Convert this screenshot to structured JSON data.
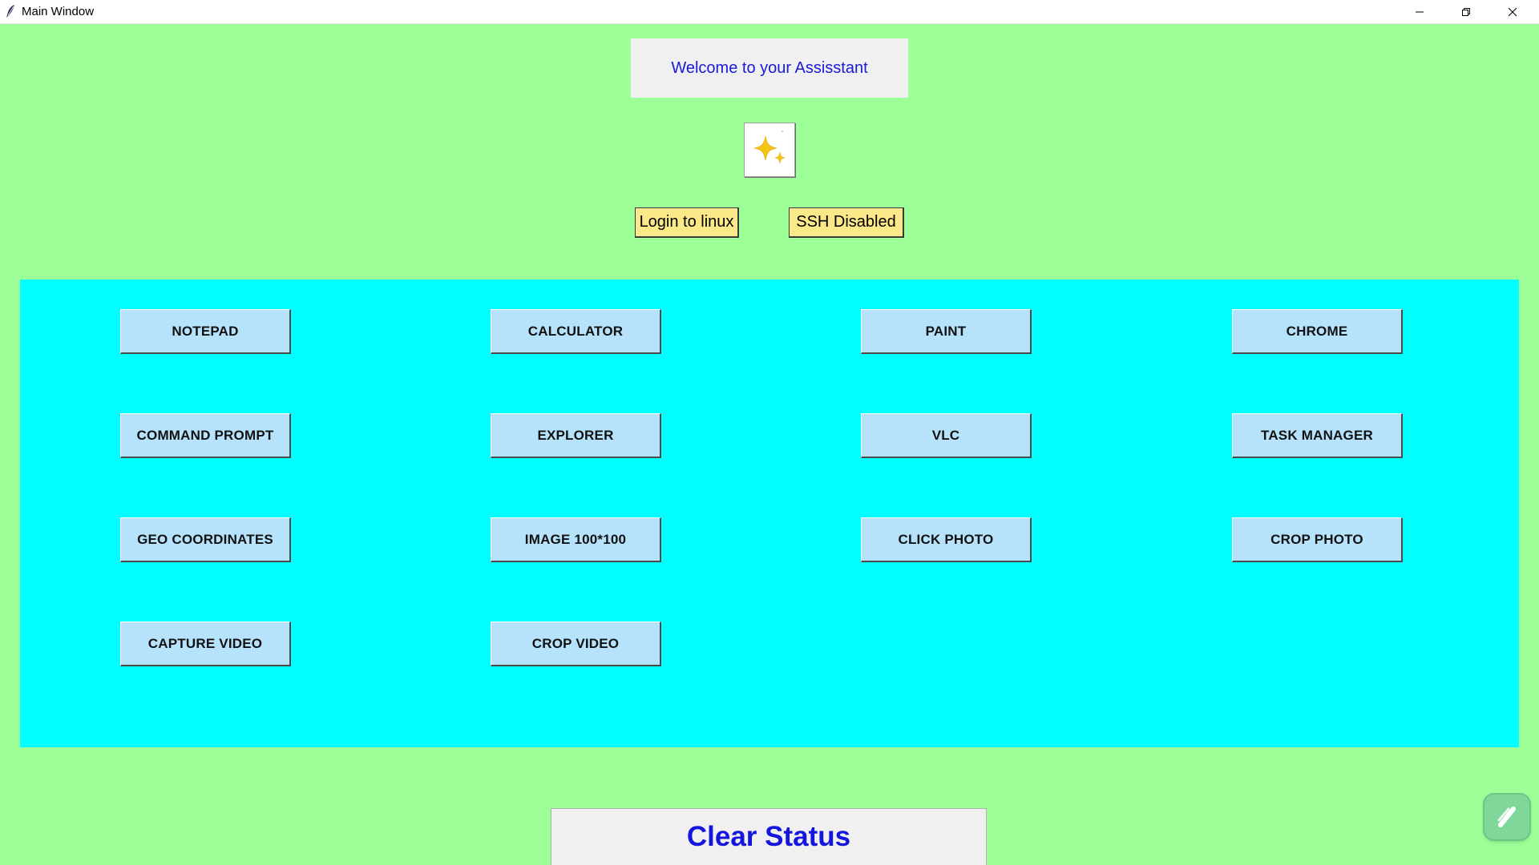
{
  "window": {
    "title": "Main Window"
  },
  "colors": {
    "background": "#9dff98",
    "panel": "#00ffff",
    "app_button": "#b6e3fb",
    "yellow_button": "#fbe889",
    "welcome_text": "#1a1ad9",
    "clear_status_text": "#1515e0"
  },
  "header": {
    "welcome": "Welcome to your Assisstant",
    "icon": "sparkle-icon"
  },
  "actions": {
    "login": "Login to linux",
    "ssh": "SSH Disabled"
  },
  "apps": [
    "NOTEPAD",
    "CALCULATOR",
    "PAINT",
    "CHROME",
    "COMMAND PROMPT",
    "EXPLORER",
    "VLC",
    "TASK MANAGER",
    "GEO COORDINATES",
    "IMAGE 100*100",
    "CLICK PHOTO",
    "CROP PHOTO",
    "CAPTURE VIDEO",
    "CROP VIDEO"
  ],
  "footer": {
    "clear_status": "Clear Status"
  }
}
